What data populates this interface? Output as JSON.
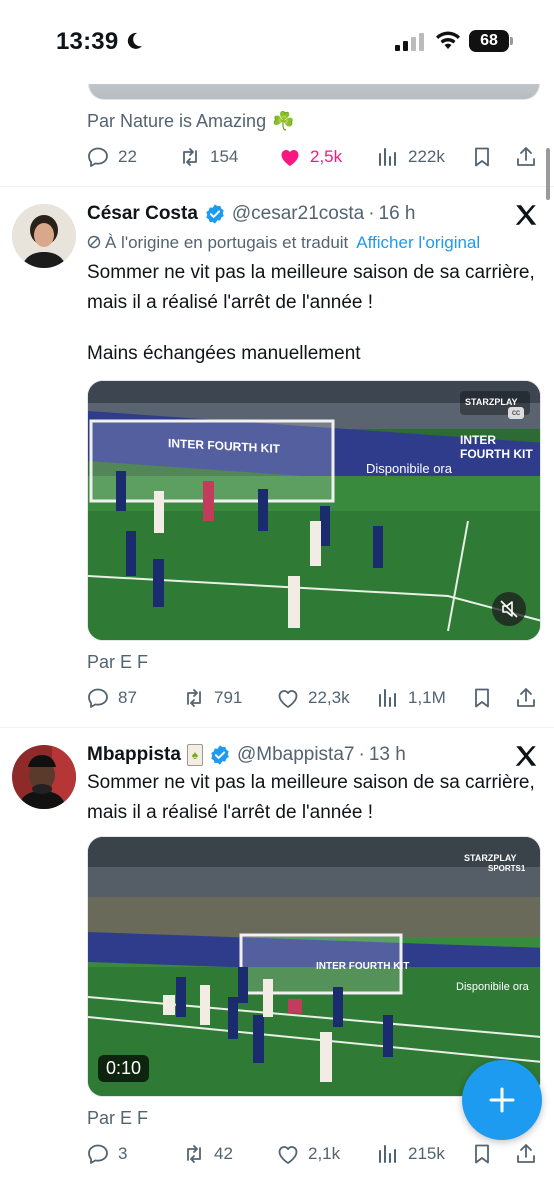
{
  "status_bar": {
    "time": "13:39",
    "battery": "68"
  },
  "tweets": [
    {
      "source": "Par Nature is Amazing",
      "source_emoji": "☘️",
      "stats": {
        "replies": "22",
        "reposts": "154",
        "likes": "2,5k",
        "views": "222k"
      }
    },
    {
      "name": "César Costa",
      "handle": "@cesar21costa",
      "time": "16 h",
      "translation_note": "À l'origine en portugais et traduit",
      "show_original": "Afficher l'original",
      "text": "Sommer ne vit pas la meilleure saison de sa carrière, mais il a réalisé l'arrêt de l'année !",
      "text2": "Mains échangées manuellement",
      "source": "Par E F",
      "stats": {
        "replies": "87",
        "reposts": "791",
        "likes": "22,3k",
        "views": "1,1M"
      }
    },
    {
      "name": "Mbappista",
      "handle": "@Mbappista7",
      "time": "13 h",
      "text": "Sommer ne vit pas la meilleure saison de sa carrière, mais il a réalisé l'arrêt de l'année !",
      "video_duration": "0:10",
      "source": "Par E F",
      "stats": {
        "replies": "3",
        "reposts": "42",
        "likes": "2,1k",
        "views": "215k"
      }
    }
  ],
  "video_overlays": {
    "board_1": "INTER FOURTH KIT",
    "board_2": "Disponibile ora",
    "brand": "STARZPLAY",
    "brand_sub": "SPORTS1",
    "cc": "cc"
  },
  "colors": {
    "accent": "#1d9bf0",
    "like": "#f91880",
    "secondary": "#536471",
    "verified": "#1d9bf0"
  },
  "icons": [
    "moon-icon",
    "signal-icon",
    "wifi-icon",
    "reply-icon",
    "repost-icon",
    "like-icon",
    "views-icon",
    "bookmark-icon",
    "share-icon",
    "verified-icon",
    "x-logo-icon",
    "translate-icon",
    "mute-icon",
    "compose-plus-icon"
  ]
}
